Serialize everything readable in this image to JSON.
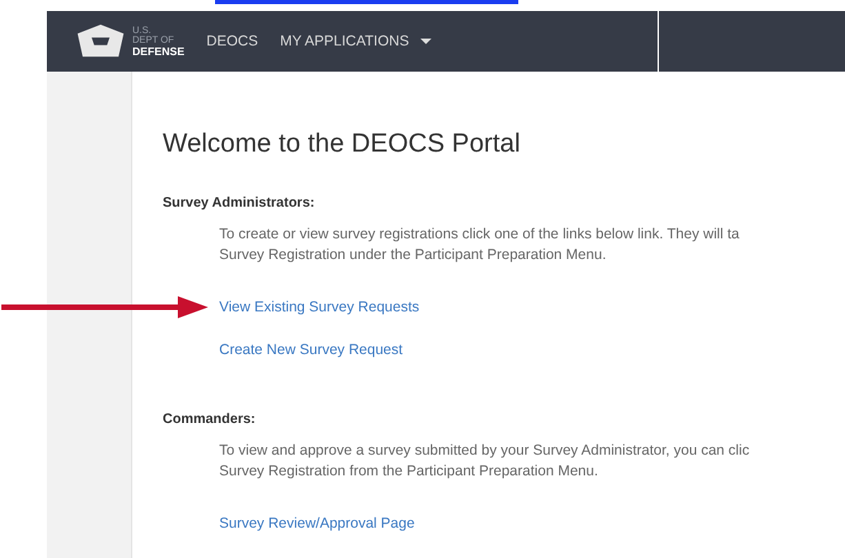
{
  "navbar": {
    "logo": {
      "line_1": "U.S.",
      "line_2": "DEPT OF",
      "line_3": "DEFENSE"
    },
    "items": [
      {
        "label": "DEOCS",
        "kind": "link"
      },
      {
        "label": "MY APPLICATIONS",
        "kind": "dropdown"
      }
    ]
  },
  "title": "Welcome to the DEOCS Portal",
  "sections": [
    {
      "heading": "Survey Administrators:",
      "text_lines": [
        "To create or view survey registrations click one of the links below link. They will ta",
        "Survey Registration under the Participant Preparation Menu."
      ],
      "links": [
        {
          "label": "View Existing Survey Requests",
          "highlighted": true
        },
        {
          "label": "Create New Survey Request",
          "highlighted": false
        }
      ]
    },
    {
      "heading": "Commanders:",
      "text_lines": [
        "To view and approve a survey submitted by your Survey Administrator, you can clic",
        "Survey Registration from the Participant Preparation Menu."
      ],
      "links": [
        {
          "label": "Survey Review/Approval Page",
          "highlighted": false
        }
      ]
    }
  ]
}
